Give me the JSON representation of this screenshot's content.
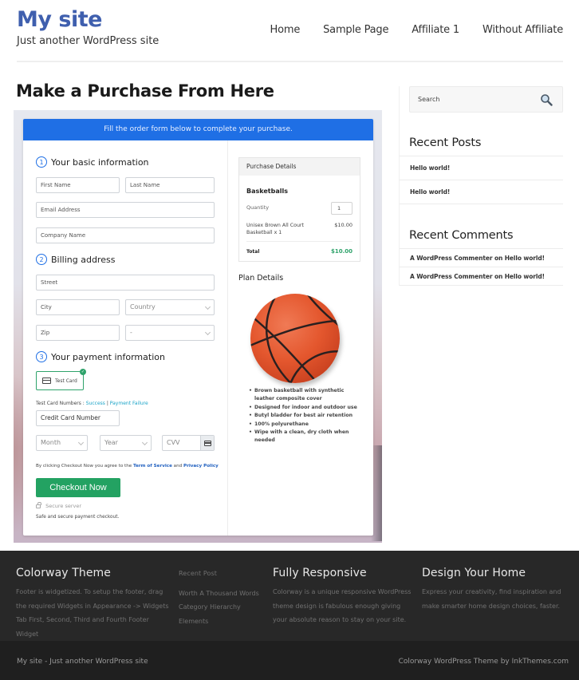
{
  "header": {
    "site_title": "My site",
    "tagline": "Just another WordPress site",
    "nav": [
      "Home",
      "Sample Page",
      "Affiliate 1",
      "Without Affiliate"
    ]
  },
  "main": {
    "page_title": "Make a Purchase From Here",
    "form": {
      "banner": "Fill the order form below to complete your purchase.",
      "steps": [
        {
          "num": "1",
          "label": "Your basic information"
        },
        {
          "num": "2",
          "label": "Billing address"
        },
        {
          "num": "3",
          "label": "Your payment information"
        }
      ],
      "fields": {
        "first_name": "First Name",
        "last_name": "Last Name",
        "email": "Email Address",
        "company": "Company Name",
        "street": "Street",
        "city": "City",
        "country": "Country",
        "zip": "Zip",
        "state": "-",
        "card_number": "Credit Card Number",
        "month": "Month",
        "year": "Year",
        "cvv": "CVV"
      },
      "payment_option": "Test Card",
      "test_numbers_label": "Test Card Numbers :",
      "test_success": "Success",
      "test_separator": "|",
      "test_failure": "Payment Failure",
      "agree_prefix": "By clicking Checkout Now you agree to the",
      "terms_link": "Term of Service",
      "agree_and": "and",
      "privacy_link": "Privacy Policy",
      "checkout_label": "Checkout Now",
      "secure_label": "Secure server",
      "safe_label": "Safe and secure payment checkout."
    },
    "purchase": {
      "header": "Purchase Details",
      "product": "Basketballs",
      "quantity_label": "Quantity",
      "quantity": "1",
      "item": "Unisex Brown All Court Basketball x 1",
      "item_price": "$10.00",
      "total_label": "Total",
      "total": "$10.00"
    },
    "plan": {
      "title": "Plan Details",
      "features": [
        "Brown basketball with synthetic leather composite cover",
        "Designed for indoor and outdoor use",
        "Butyl bladder for best air retention",
        "100% polyurethane",
        "Wipe with a clean, dry cloth when needed"
      ]
    }
  },
  "sidebar": {
    "search_placeholder": "Search",
    "recent_posts_title": "Recent Posts",
    "recent_posts": [
      "Hello world!",
      "Hello world!"
    ],
    "recent_comments_title": "Recent Comments",
    "recent_comments": [
      "A WordPress Commenter on Hello world!",
      "A WordPress Commenter on Hello world!"
    ]
  },
  "footer": {
    "columns": [
      {
        "title": "Colorway Theme",
        "text": "Footer is widgetized. To setup the footer, drag the required Widgets in Appearance -> Widgets Tab First, Second, Third and Fourth Footer Widget"
      },
      {
        "title": "Recent Post",
        "links": [
          "Worth A Thousand Words",
          "Category Hierarchy",
          "Elements"
        ]
      },
      {
        "title": "Fully Responsive",
        "text": "Colorway is a unique responsive WordPress theme design is fabulous enough giving your absolute reason to stay on your site."
      },
      {
        "title": "Design Your Home",
        "text": "Express your creativity, find inspiration and make smarter home design choices, faster."
      }
    ],
    "bottom_left": "My site - Just another WordPress site",
    "bottom_right": "Colorway WordPress Theme by InkThemes.com"
  },
  "colors": {
    "brand_blue": "#3f5fae",
    "banner_blue": "#1f6fe5",
    "checkout_green": "#23a262",
    "total_green": "#2fa36b",
    "footer_bg": "#282828"
  }
}
